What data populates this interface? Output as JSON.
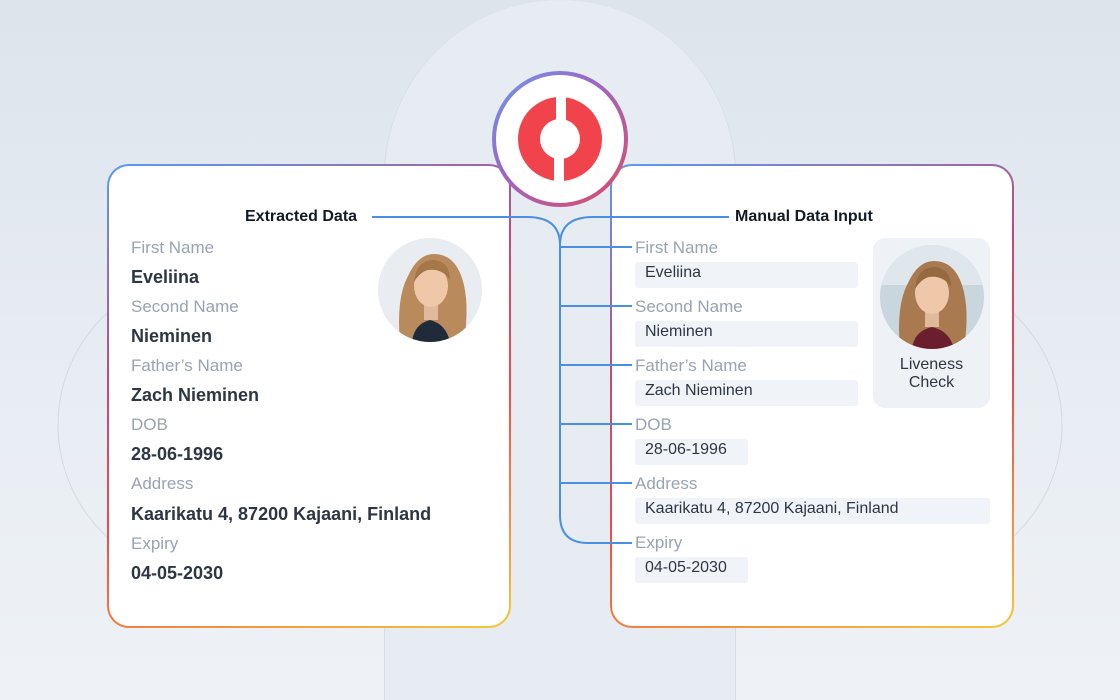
{
  "extracted": {
    "title": "Extracted Data",
    "fields": [
      {
        "label": "First Name",
        "value": "Eveliina"
      },
      {
        "label": "Second Name",
        "value": "Nieminen"
      },
      {
        "label": "Father’s Name",
        "value": "Zach Nieminen"
      },
      {
        "label": "DOB",
        "value": "28-06-1996"
      },
      {
        "label": "Address",
        "value": "Kaarikatu 4, 87200 Kajaani, Finland"
      },
      {
        "label": "Expiry",
        "value": "04-05-2030"
      }
    ]
  },
  "manual": {
    "title": "Manual Data Input",
    "fields": [
      {
        "label": "First Name",
        "value": "Eveliina"
      },
      {
        "label": "Second Name",
        "value": "Nieminen"
      },
      {
        "label": "Father’s Name",
        "value": "Zach Nieminen"
      },
      {
        "label": "DOB",
        "value": "28-06-1996"
      },
      {
        "label": "Address",
        "value": "Kaarikatu 4, 87200 Kajaani, Finland"
      },
      {
        "label": "Expiry",
        "value": "04-05-2030"
      }
    ],
    "liveness": {
      "line1": "Liveness",
      "line2": "Check"
    }
  },
  "icons": {
    "logo": "brand-logo-icon",
    "portrait": "person-portrait-icon"
  },
  "colors": {
    "connector": "#4a90e2",
    "brand_red": "#f0434b",
    "label_gray": "#98a3b3",
    "value_dark": "#2e3644",
    "field_bg": "#f0f4f8"
  }
}
